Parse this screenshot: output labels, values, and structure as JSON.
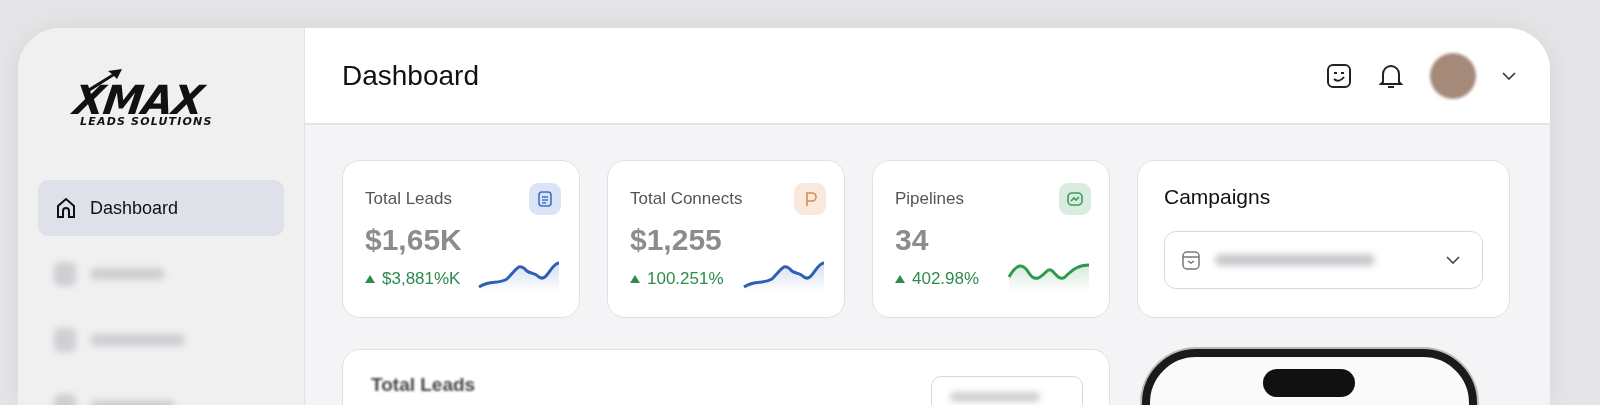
{
  "logo": {
    "title": "XMAX",
    "subtitle": "LEADS SOLUTIONS"
  },
  "sidebar": {
    "items": [
      {
        "label": "Dashboard",
        "selected": true
      }
    ]
  },
  "header": {
    "title": "Dashboard"
  },
  "stats": [
    {
      "title": "Total Leads",
      "value": "$1,65K",
      "change": "$3,881%K",
      "trend_up": true,
      "color": "#3f6fc9",
      "sparkline": {
        "color": "#2f5fb3"
      }
    },
    {
      "title": "Total Connects",
      "value": "$1,255",
      "change": "100.251%",
      "trend_up": true,
      "color": "#d98a4e",
      "sparkline": {
        "color": "#2f5fb3"
      }
    },
    {
      "title": "Pipelines",
      "value": "34",
      "change": "402.98%",
      "trend_up": true,
      "color": "#3a9a5c",
      "sparkline": {
        "color": "#2e9a4e"
      }
    }
  ],
  "campaigns": {
    "title": "Campaigns"
  },
  "leads_panel": {
    "title": "Total Leads"
  }
}
